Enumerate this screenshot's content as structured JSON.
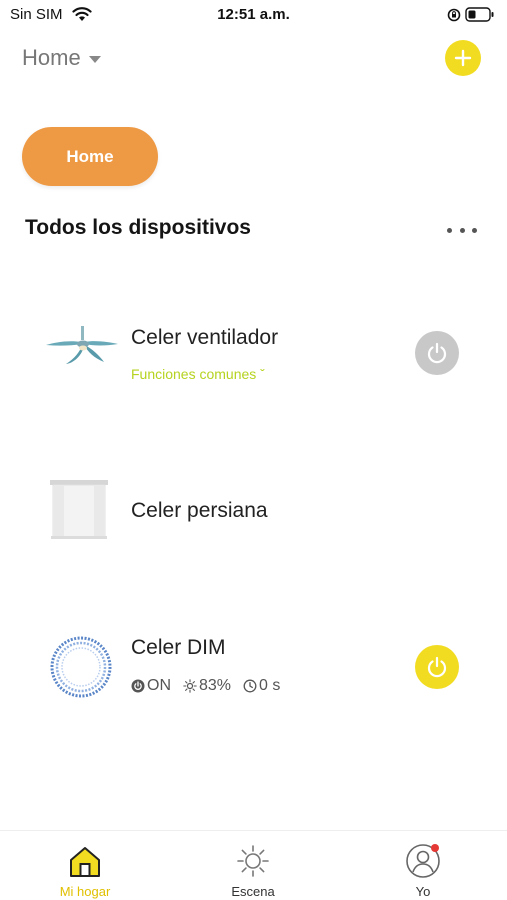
{
  "status_bar": {
    "carrier": "Sin SIM",
    "time": "12:51 a.m."
  },
  "header": {
    "home_label": "Home"
  },
  "room_tab": {
    "label": "Home"
  },
  "section": {
    "title": "Todos los dispositivos"
  },
  "devices": [
    {
      "name": "Celer ventilador",
      "sub": "Funciones comunes ˇ",
      "power": "off",
      "icon": "ceiling-fan-icon"
    },
    {
      "name": "Celer persiana",
      "icon": "blind-icon"
    },
    {
      "name": "Celer DIM",
      "status_on": "ON",
      "status_brightness": "83%",
      "status_timer": "0 s",
      "power": "on",
      "icon": "led-strip-icon"
    }
  ],
  "tabs": [
    {
      "label": "Mi hogar",
      "icon": "home-icon",
      "active": true
    },
    {
      "label": "Escena",
      "icon": "sun-icon",
      "active": false
    },
    {
      "label": "Yo",
      "icon": "user-icon",
      "active": false,
      "badge": true
    }
  ],
  "colors": {
    "accent": "#f2dc21",
    "room_pill": "#ee9a45",
    "sub_text": "#b6d320",
    "power_off": "#c8c8c8",
    "power_on": "#f2dc21",
    "badge": "#e53935"
  }
}
